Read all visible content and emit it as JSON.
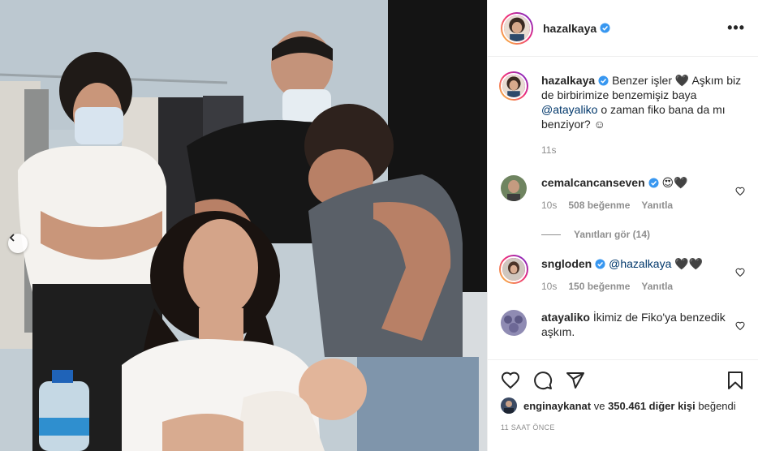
{
  "post": {
    "author": "hazalkaya",
    "caption_text_1": "Benzer işler",
    "caption_heart": "🖤",
    "caption_text_2": "Aşkım biz de birbirimize benzemişiz baya",
    "caption_mention": "@atayaliko",
    "caption_text_3": "o zaman fiko bana da mı benziyor? ☺",
    "caption_time": "11s",
    "more_icon": "more-horizontal-icon"
  },
  "comments": [
    {
      "user": "cemalcancanseven",
      "verified": true,
      "text": "😍🖤",
      "time": "10s",
      "likes": "508 beğenme",
      "reply": "Yanıtla",
      "view_replies": "Yanıtları gör (14)"
    },
    {
      "user": "sngloden",
      "verified": true,
      "mention": "@hazalkaya",
      "text": "🖤🖤",
      "time": "10s",
      "likes": "150 beğenme",
      "reply": "Yanıtla"
    },
    {
      "user": "atayaliko",
      "verified": false,
      "text": "İkimiz de Fiko'ya benzedik aşkım."
    }
  ],
  "footer": {
    "liked_by_user": "enginaykanat",
    "liked_by_and": "ve",
    "liked_by_others": "350.461 diğer kişi",
    "liked_by_suffix": "beğendi",
    "date": "11 SAAT ÖNCE"
  },
  "colors": {
    "verified_blue": "#3897f0",
    "text_primary": "#262626",
    "text_secondary": "#8e8e8e",
    "mention": "#00376b",
    "border": "#efefef"
  },
  "icons": [
    "heart-icon",
    "comment-icon",
    "share-icon",
    "bookmark-icon",
    "chevron-left-icon",
    "verified-badge-icon"
  ]
}
